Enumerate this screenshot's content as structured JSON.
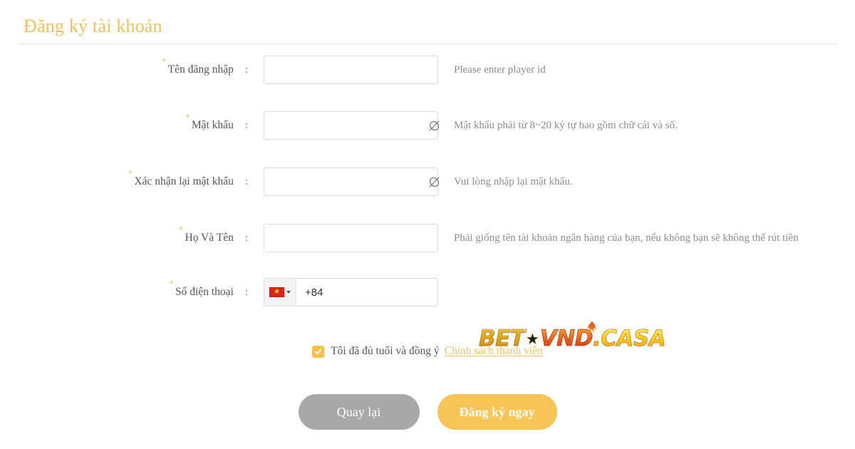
{
  "header": {
    "title": "Đăng ký tài khoản"
  },
  "form": {
    "required_marker": "*",
    "colon": ":",
    "fields": [
      {
        "name": "username",
        "label": "Tên đăng nhập",
        "value": "",
        "placeholder": "",
        "hint": "Please enter player id"
      },
      {
        "name": "password",
        "label": "Mật khẩu",
        "value": "",
        "placeholder": "",
        "hint": "Mật khẩu phải từ 8~20 ký tự bao gồm chữ cái và số.",
        "toggle_icon": "eye-slash-icon"
      },
      {
        "name": "confirm-password",
        "label": "Xác nhận lại mật khẩu",
        "value": "",
        "placeholder": "",
        "hint": "Vui lòng nhập lại mật khẩu.",
        "toggle_icon": "eye-slash-icon"
      },
      {
        "name": "fullname",
        "label": "Họ Và Tên",
        "value": "",
        "placeholder": "",
        "hint": "Phải giống tên tài khoản ngân hàng của bạn, nếu không bạn sẽ không thể rút tiền"
      },
      {
        "name": "phone",
        "label": "Số điện thoại",
        "value": "",
        "placeholder": "",
        "hint": "",
        "country_flag": "vietnam-flag-icon",
        "dial_code": "+84",
        "dropdown_icon": "caret-down-icon"
      }
    ]
  },
  "logo": {
    "part1": "BET",
    "star": "★",
    "part2": "VND",
    "part3": ".CASA",
    "full_text": "BET★VND.CASA",
    "flame_icon": "flame-icon"
  },
  "agreement": {
    "checked": true,
    "check_icon": "check-icon",
    "text": "Tôi đã đủ tuổi và đồng ý",
    "link_text": "Chính sách thành viên"
  },
  "buttons": {
    "back": "Quay lại",
    "register": "Đăng ký ngay"
  },
  "colors": {
    "title": "#efc157",
    "accent": "#f7c456",
    "required_star": "#f2bf4d",
    "link": "#f0c25b",
    "back_button": "#a8a8a8",
    "hint_text": "#8d8d8d",
    "label_text": "#555555",
    "input_border": "#dcdcdc",
    "divider": "#e8e8e8",
    "flag_red": "#da251d",
    "flag_star": "#ffd900"
  }
}
